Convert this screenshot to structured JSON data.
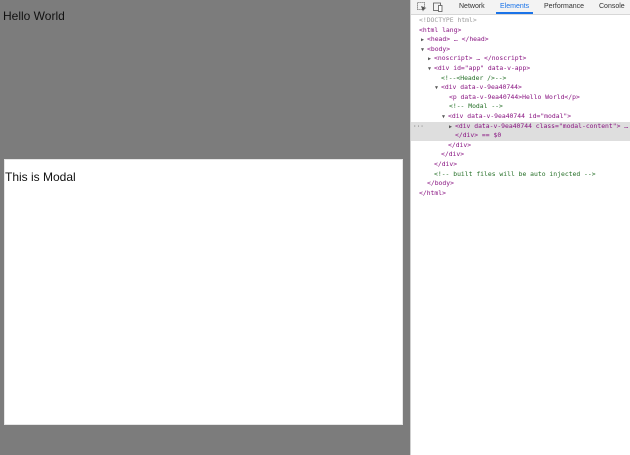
{
  "page": {
    "hello_text": "Hello World",
    "modal_title": "This is Modal"
  },
  "devtools": {
    "tabs": [
      {
        "label": "Network",
        "active": false
      },
      {
        "label": "Elements",
        "active": true
      },
      {
        "label": "Performance",
        "active": false
      },
      {
        "label": "Console",
        "active": false
      }
    ],
    "rows": [
      {
        "text": "<!DOCTYPE html>"
      },
      {
        "text": "<html lang>"
      },
      {
        "text": "<head> … </head>"
      },
      {
        "text": "<body>"
      },
      {
        "text": "<noscript> … </noscript>"
      },
      {
        "text": "<div id=\"app\" data-v-app>"
      },
      {
        "text": "<!--<Header />-->"
      },
      {
        "text": "<div data-v-9ea40744>"
      },
      {
        "text": "<p data-v-9ea40744>Hello World</p>"
      },
      {
        "text": "<!-- Modal -->"
      },
      {
        "text": "<div data-v-9ea40744 id=\"modal\">"
      },
      {
        "text": "<div data-v-9ea40744 class=\"modal-content\"> …"
      },
      {
        "text": "</div> == $0"
      },
      {
        "text": "</div>"
      },
      {
        "text": "</div>"
      },
      {
        "text": "</div>"
      },
      {
        "text": "<!-- built files will be auto injected -->"
      },
      {
        "text": "</body>"
      },
      {
        "text": "</html>"
      }
    ]
  },
  "colors": {
    "viewport_bg": "#7c7c7c",
    "modal_bg": "#ffffff",
    "active_tab": "#1a73e8",
    "tag": "#881280",
    "attr": "#994500",
    "value": "#1a1aa6",
    "comment": "#236e25"
  },
  "icons": [
    "inspect-element-icon",
    "device-toolbar-icon"
  ]
}
